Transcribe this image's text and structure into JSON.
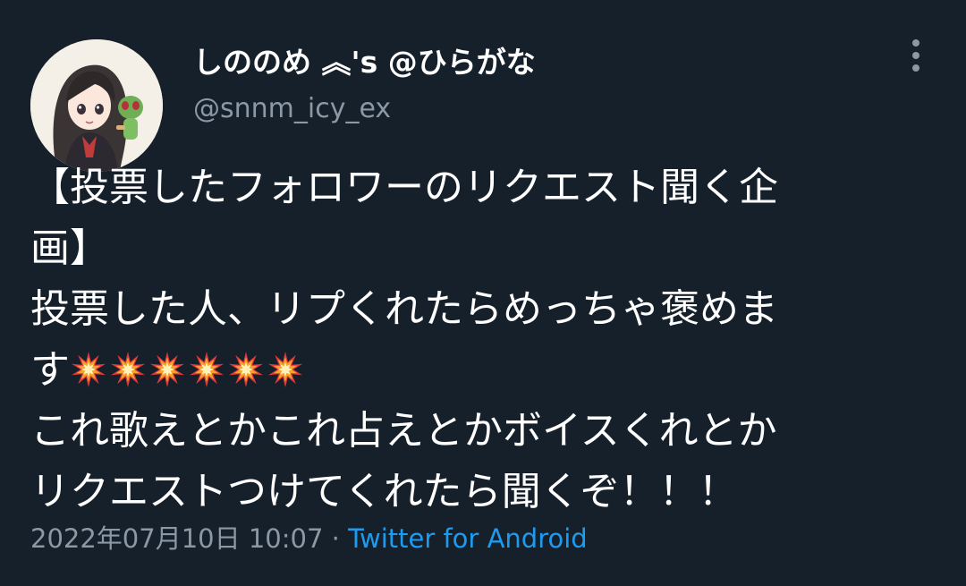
{
  "tweet": {
    "display_name": "しののめ ︽'s @ひらがな",
    "handle": "@snnm_icy_ex",
    "body_lines": [
      "【投票したフォロワーのリクエスト聞く企",
      "画】",
      "投票した人、リプくれたらめっちゃ褒めま",
      "す",
      "これ歌えとかこれ占えとかボイスくれとか",
      "リクエストつけてくれたら聞くぞ！！！"
    ],
    "emoji_name": "collision-emoji",
    "emoji_count": 6,
    "timestamp": "2022年07月10日 10:07",
    "separator": " · ",
    "source": "Twitter for Android"
  },
  "colors": {
    "background": "#15202b",
    "text": "#ffffff",
    "secondary": "#8b98a5",
    "link": "#1d9bf0"
  }
}
